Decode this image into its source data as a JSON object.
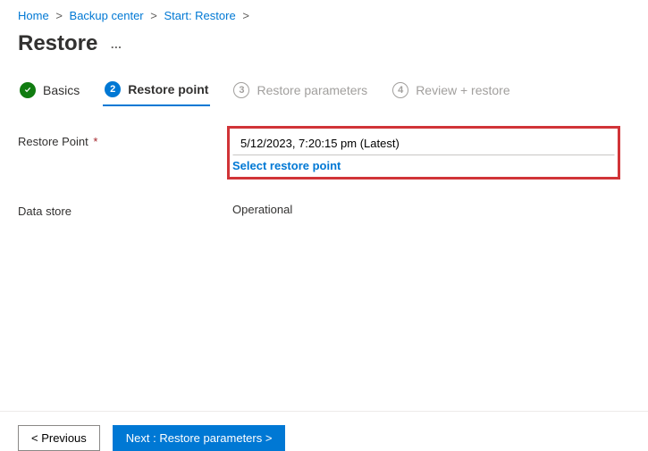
{
  "breadcrumb": {
    "items": [
      {
        "label": "Home"
      },
      {
        "label": "Backup center"
      },
      {
        "label": "Start: Restore"
      }
    ]
  },
  "header": {
    "title": "Restore",
    "more": "…"
  },
  "tabs": {
    "items": [
      {
        "label": "Basics",
        "state": "completed"
      },
      {
        "num": "2",
        "label": "Restore point",
        "state": "active"
      },
      {
        "num": "3",
        "label": "Restore parameters",
        "state": "future"
      },
      {
        "num": "4",
        "label": "Review + restore",
        "state": "future"
      }
    ]
  },
  "form": {
    "restorePoint": {
      "label": "Restore Point",
      "required": "*",
      "value": "5/12/2023, 7:20:15 pm (Latest)",
      "selectLink": "Select restore point"
    },
    "dataStore": {
      "label": "Data store",
      "value": "Operational"
    }
  },
  "footer": {
    "prev": "< Previous",
    "next": "Next : Restore parameters >"
  }
}
